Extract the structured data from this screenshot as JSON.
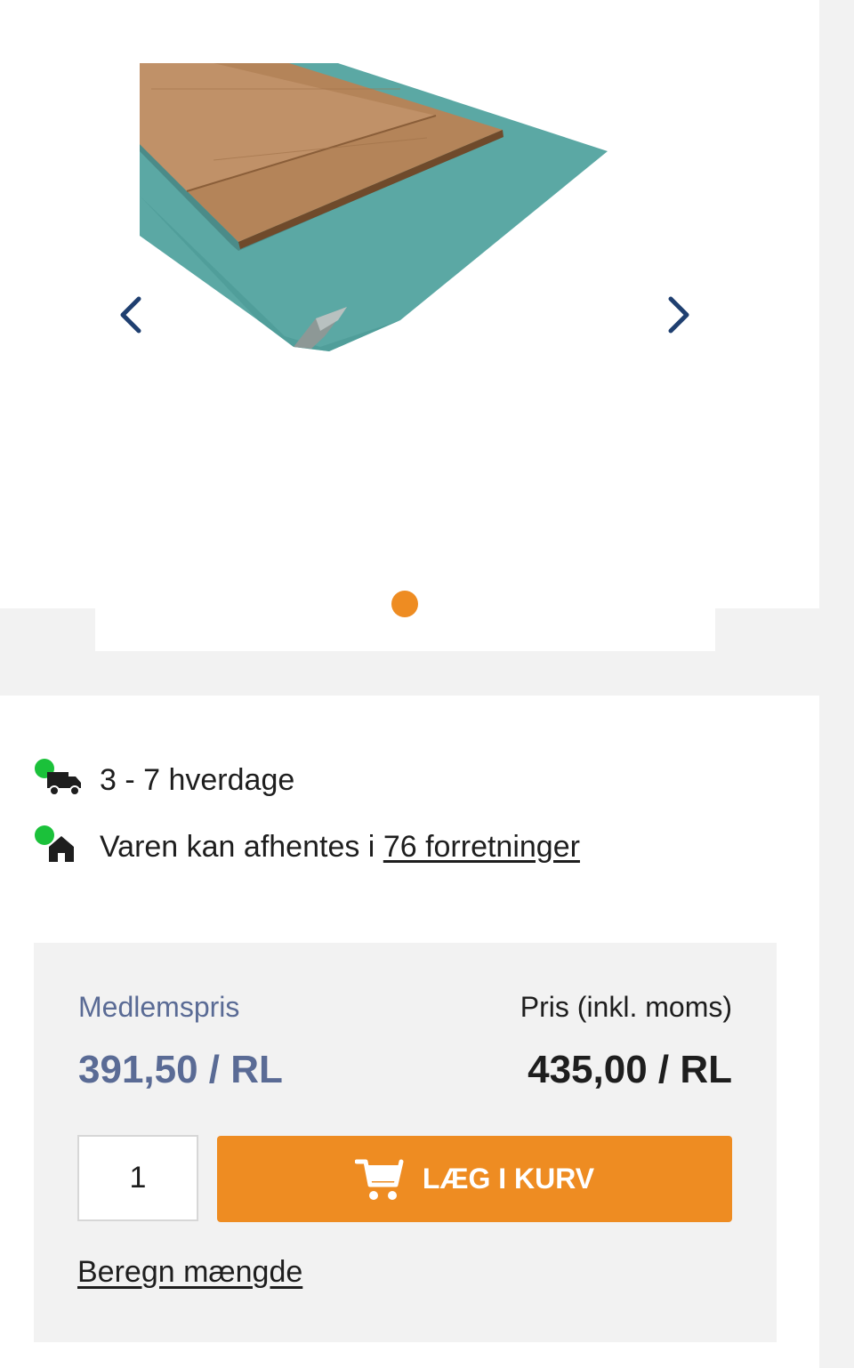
{
  "gallery": {
    "image_alt": "Produktbillede: underlag med laminatplank",
    "prev_icon": "chevron-left-icon",
    "next_icon": "chevron-right-icon",
    "active_slide": 1,
    "slide_count": 1
  },
  "availability": {
    "delivery": {
      "status": "in-stock",
      "icon": "delivery-truck-icon",
      "text": "3 - 7 hverdage"
    },
    "pickup": {
      "status": "in-stock",
      "icon": "store-house-icon",
      "text_prefix": "Varen kan afhentes i ",
      "link_text": "76 forretninger"
    }
  },
  "pricing": {
    "member_label": "Medlemspris",
    "member_price": "391,50 / RL",
    "regular_label": "Pris (inkl. moms)",
    "regular_price": "435,00 / RL"
  },
  "purchase": {
    "quantity": "1",
    "add_to_cart_label": "LÆG I KURV",
    "cart_icon": "shopping-cart-icon",
    "calc_link": "Beregn mængde"
  },
  "colors": {
    "accent": "#ee8c22",
    "member_price": "#5a6b95",
    "status_green": "#1bc13a",
    "nav_arrow": "#1f3f70"
  }
}
